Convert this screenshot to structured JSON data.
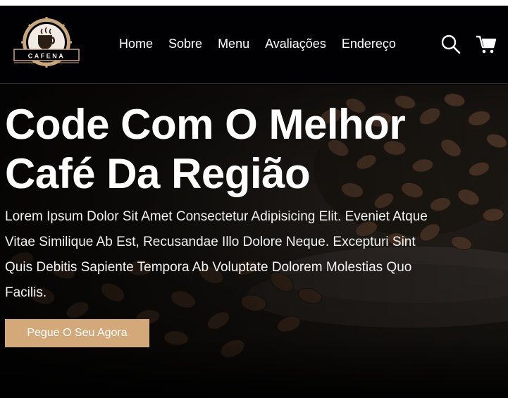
{
  "brand": {
    "logo_text": "CAFENA"
  },
  "nav": {
    "items": [
      {
        "label": "Home"
      },
      {
        "label": "Sobre"
      },
      {
        "label": "Menu"
      },
      {
        "label": "Avaliações"
      },
      {
        "label": "Endereço"
      }
    ]
  },
  "header_icons": [
    "search-icon",
    "cart-icon"
  ],
  "hero": {
    "title_line1": "Code Com O Melhor",
    "title_line2": "Café Da Região",
    "text": "Lorem Ipsum Dolor Sit Amet Consectetur Adipisicing Elit. Eveniet Atque Vitae Similique Ab Est, Recusandae Illo Dolore Neque. Excepturi Sint Quis Debitis Sapiente Tempora Ab Voluptate Dolorem Molestias Quo Facilis.",
    "cta_label": "Pegue O Seu Agora"
  },
  "colors": {
    "accent": "#d3a97a",
    "header_bg": "#010103",
    "logo_gold": "#c9a77c"
  }
}
